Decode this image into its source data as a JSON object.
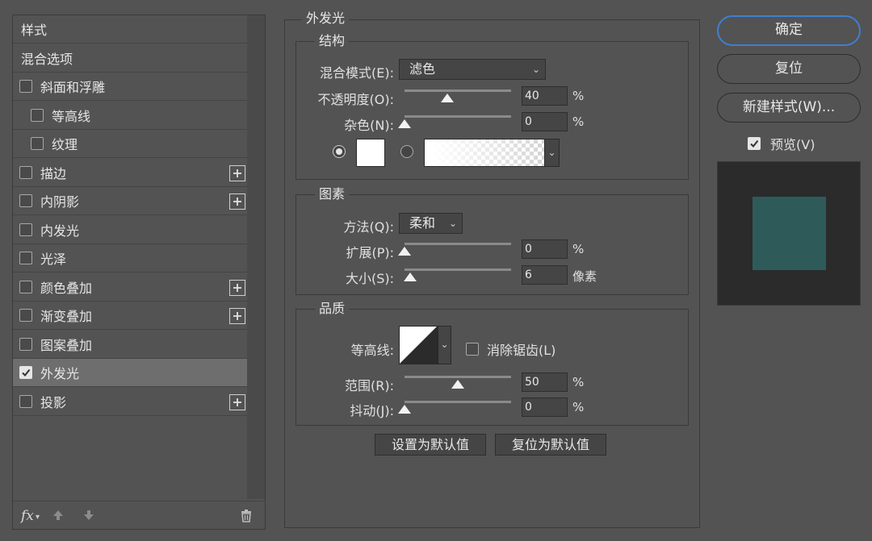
{
  "left": {
    "items": [
      {
        "label": "样式",
        "checkbox": null
      },
      {
        "label": "混合选项",
        "checkbox": null
      },
      {
        "label": "斜面和浮雕",
        "checkbox": false,
        "indent": 0,
        "plus": false
      },
      {
        "label": "等高线",
        "checkbox": false,
        "indent": 1,
        "plus": false
      },
      {
        "label": "纹理",
        "checkbox": false,
        "indent": 1,
        "plus": false
      },
      {
        "label": "描边",
        "checkbox": false,
        "indent": 0,
        "plus": true
      },
      {
        "label": "内阴影",
        "checkbox": false,
        "indent": 0,
        "plus": true
      },
      {
        "label": "内发光",
        "checkbox": false,
        "indent": 0,
        "plus": false
      },
      {
        "label": "光泽",
        "checkbox": false,
        "indent": 0,
        "plus": false
      },
      {
        "label": "颜色叠加",
        "checkbox": false,
        "indent": 0,
        "plus": true
      },
      {
        "label": "渐变叠加",
        "checkbox": false,
        "indent": 0,
        "plus": true
      },
      {
        "label": "图案叠加",
        "checkbox": false,
        "indent": 0,
        "plus": false
      },
      {
        "label": "外发光",
        "checkbox": true,
        "indent": 0,
        "plus": false,
        "selected": true
      },
      {
        "label": "投影",
        "checkbox": false,
        "indent": 0,
        "plus": true
      }
    ],
    "footer": {
      "fx": "fx"
    }
  },
  "main": {
    "title": "外发光",
    "structure": {
      "title": "结构",
      "blend_label": "混合模式(E):",
      "blend_value": "滤色",
      "opacity_label": "不透明度(O):",
      "opacity_value": "40",
      "opacity_unit": "%",
      "opacity_level": 40,
      "noise_label": "杂色(N):",
      "noise_value": "0",
      "noise_unit": "%",
      "noise_level": 0,
      "color_swatch": "#ffffff"
    },
    "elements": {
      "title": "图素",
      "method_label": "方法(Q):",
      "method_value": "柔和",
      "spread_label": "扩展(P):",
      "spread_value": "0",
      "spread_unit": "%",
      "spread_level": 0,
      "size_label": "大小(S):",
      "size_value": "6",
      "size_unit": "像素",
      "size_level": 6
    },
    "quality": {
      "title": "品质",
      "contour_label": "等高线:",
      "antialias_label": "消除锯齿(L)",
      "antialias_checked": false,
      "range_label": "范围(R):",
      "range_value": "50",
      "range_unit": "%",
      "range_level": 50,
      "jitter_label": "抖动(J):",
      "jitter_value": "0",
      "jitter_unit": "%",
      "jitter_level": 0
    },
    "buttons": {
      "set_default": "设置为默认值",
      "reset_default": "复位为默认值"
    }
  },
  "right": {
    "ok": "确定",
    "reset": "复位",
    "new_style": "新建样式(W)...",
    "preview_label": "预览(V)",
    "preview_checked": true,
    "preview_color": "#2e5b5a"
  }
}
